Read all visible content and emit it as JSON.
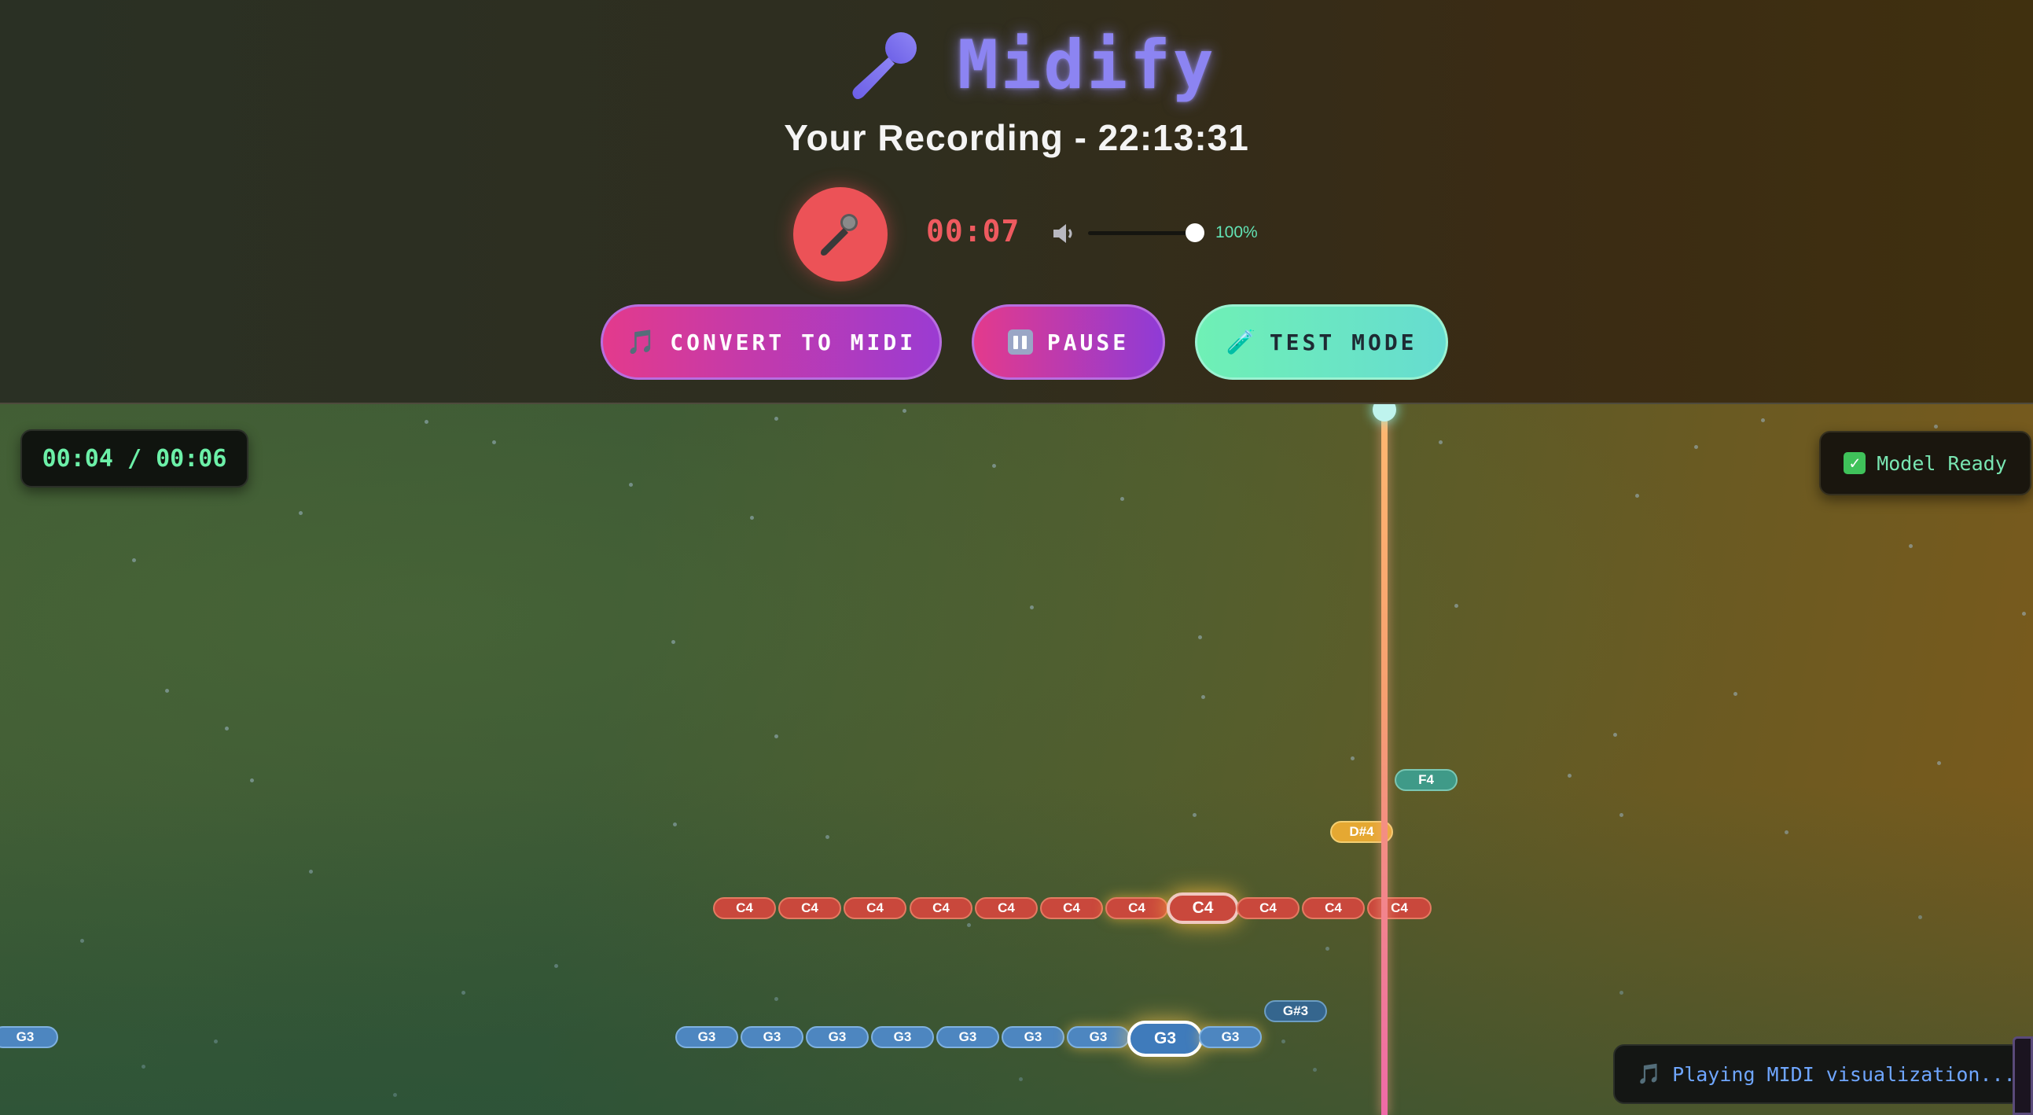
{
  "app": {
    "title": "Midify",
    "subtitle": "Your Recording - 22:13:31"
  },
  "recorder": {
    "record_icon": "microphone-icon",
    "elapsed": "00:07",
    "volume_icon": "speaker-icon",
    "volume_level": 1.0,
    "volume_label": "100%"
  },
  "actions": {
    "convert": {
      "icon": "🎵",
      "label": "CONVERT TO MIDI"
    },
    "pause": {
      "icon": "pause-icon",
      "label": "PAUSE"
    },
    "test": {
      "icon": "🧪",
      "label": "TEST MODE"
    }
  },
  "visualizer": {
    "time_display": "00:04 / 00:06",
    "model_status": {
      "icon": "check-icon",
      "label": "Model Ready"
    },
    "status_message": {
      "icon": "🎵",
      "label": "Playing MIDI visualization..."
    },
    "notes": {
      "c4_row": [
        "C4",
        "C4",
        "C4",
        "C4",
        "C4",
        "C4",
        "C4",
        "C4",
        "C4",
        "C4",
        "C4"
      ],
      "g3_row": [
        "G3",
        "G3",
        "G3",
        "G3",
        "G3",
        "G3",
        "G3",
        "G3",
        "G3"
      ],
      "g3_left": "G3",
      "f4": "F4",
      "ds4": "D#4",
      "gs3": "G#3"
    }
  },
  "colors": {
    "accent_purple": "#8c84f2",
    "record_red": "#ec5257",
    "note_c4": "#c9483c",
    "note_g3": "#4d86c0",
    "note_f4": "#3f9a88",
    "note_ds4": "#e5a832",
    "note_gs3": "#35668e",
    "status_green": "#6cf0a8"
  }
}
